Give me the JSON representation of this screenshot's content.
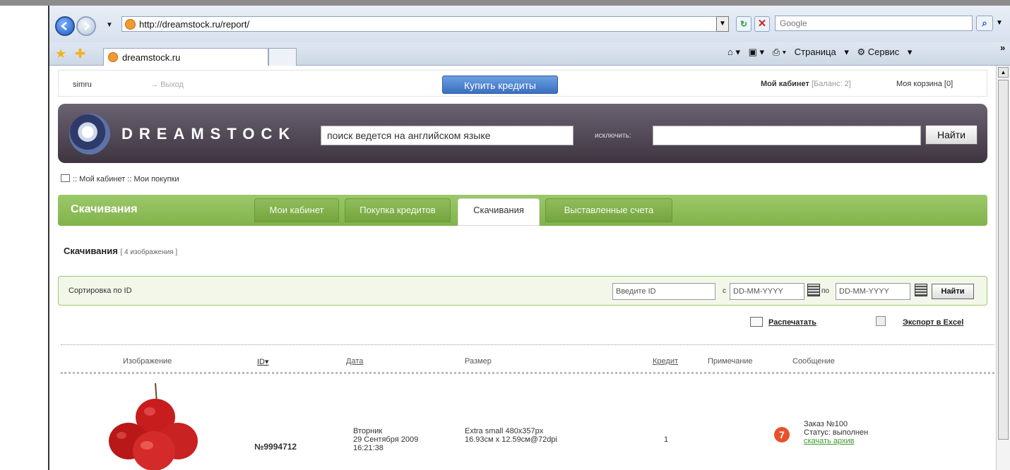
{
  "browser": {
    "url": "http://dreamstock.ru/report/",
    "search_placeholder": "Google",
    "tab_title": "dreamstock.ru",
    "cmd_page": "Страница",
    "cmd_service": "Сервис"
  },
  "topline": {
    "username": "simru",
    "logout": "Выход",
    "buy_credits": "Купить кредиты",
    "cabinet": "Мой кабинет",
    "balance": "[Баланс: 2]",
    "cart": "Моя корзина [0]"
  },
  "header": {
    "logo": "DREAMSTOCK",
    "search_value": "поиск ведется на английском языке",
    "exclude_label": "исключить:",
    "find_button": "Найти"
  },
  "breadcrumb": ":: Мой кабинет :: Мои покупки",
  "section": {
    "title": "Скачивания",
    "tabs": [
      {
        "label": "Мои кабинет"
      },
      {
        "label": "Покупка кредитов"
      },
      {
        "label": "Скачивания"
      },
      {
        "label": "Выставленные счета"
      }
    ],
    "heading": "Скачивания",
    "count": "[ 4 изображения ]"
  },
  "filter": {
    "label": "Сортировка по ID",
    "id_placeholder": "Введите ID",
    "from_label": "с",
    "from_placeholder": "DD-MM-YYYY",
    "to_label": "по",
    "to_placeholder": "DD-MM-YYYY",
    "find_button": "Найти"
  },
  "actions": {
    "print": "Распечатать",
    "export": "Экспорт в Excel"
  },
  "table": {
    "headers": {
      "image": "Изображение",
      "id": "ID▾",
      "date": "Дата",
      "size": "Размер",
      "credit": "Кредит",
      "note": "Примечание",
      "message": "Сообщение"
    },
    "rows": [
      {
        "id": "№9994712",
        "date_day": "Вторник",
        "date_full": "29 Сентября 2009",
        "time": "16:21:38",
        "size_1": "Extra small 480x357px",
        "size_2": "16.93см x 12.59см@72dpi",
        "credit": "1",
        "badge": "7",
        "order": "Заказ №100",
        "status": "Статус: выполнен",
        "download": "скачать архив"
      }
    ]
  }
}
